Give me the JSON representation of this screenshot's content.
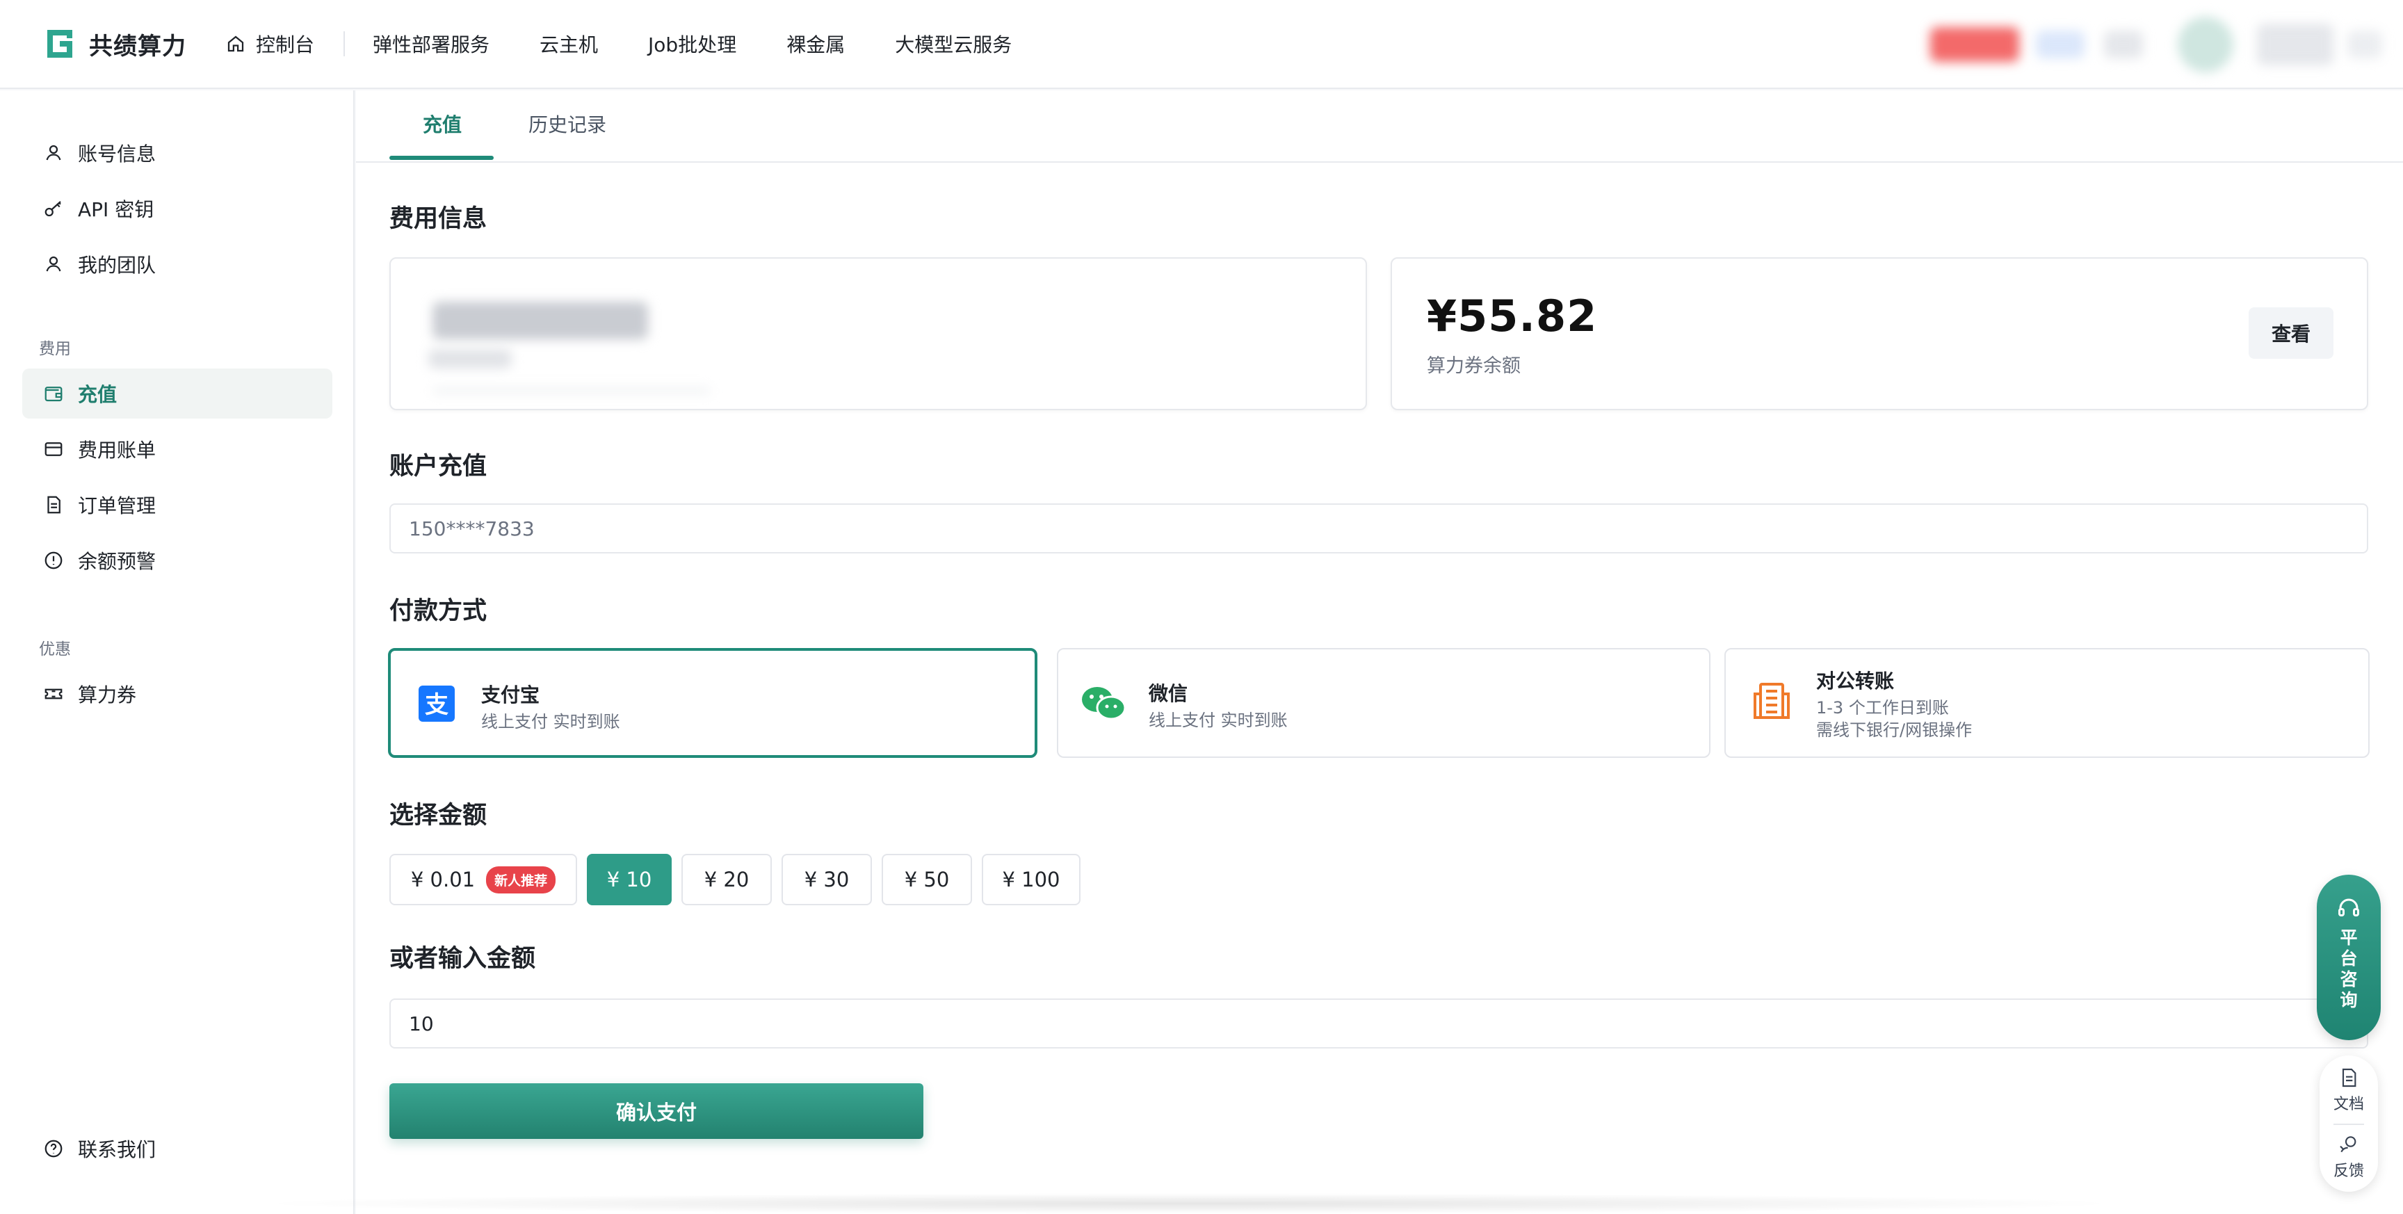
{
  "app": {
    "brand_name": "共绩算力"
  },
  "topnav": {
    "home": "控制台",
    "items": [
      "弹性部署服务",
      "云主机",
      "Job批处理",
      "裸金属",
      "大模型云服务"
    ]
  },
  "sidebar": {
    "account_items": [
      {
        "label": "账号信息",
        "icon": "user-icon"
      },
      {
        "label": "API 密钥",
        "icon": "key-icon"
      },
      {
        "label": "我的团队",
        "icon": "user-icon"
      }
    ],
    "fee_group": "费用",
    "fee_items": [
      {
        "label": "充值",
        "icon": "wallet-icon",
        "active": true
      },
      {
        "label": "费用账单",
        "icon": "card-icon"
      },
      {
        "label": "订单管理",
        "icon": "document-icon"
      },
      {
        "label": "余额预警",
        "icon": "alert-icon"
      }
    ],
    "promo_group": "优惠",
    "promo_items": [
      {
        "label": "算力券",
        "icon": "ticket-icon"
      }
    ],
    "contact": "联系我们"
  },
  "tabs": {
    "recharge": "充值",
    "history": "历史记录"
  },
  "fee_info": {
    "title": "费用信息",
    "voucher_amount": "¥55.82",
    "voucher_label": "算力券余额",
    "view_button": "查看"
  },
  "account_recharge": {
    "title": "账户充值",
    "account": "150****7833"
  },
  "payment": {
    "title": "付款方式",
    "methods": [
      {
        "name": "支付宝",
        "desc": "线上支付 实时到账",
        "icon": "alipay-icon",
        "selected": true
      },
      {
        "name": "微信",
        "desc": "线上支付 实时到账",
        "icon": "wechat-icon"
      },
      {
        "name": "对公转账",
        "desc": "1-3 个工作日到账",
        "desc2": "需线下银行/网银操作",
        "icon": "building-icon"
      }
    ]
  },
  "amount": {
    "title": "选择金额",
    "options": [
      "¥ 0.01",
      "¥ 10",
      "¥ 20",
      "¥ 30",
      "¥ 50",
      "¥ 100"
    ],
    "selected_index": 1,
    "new_user_badge": "新人推荐"
  },
  "custom_amount": {
    "title": "或者输入金额",
    "value": "10"
  },
  "confirm_button": "确认支付",
  "floating": {
    "consult": "平台咨询",
    "docs": "文档",
    "feedback": "反馈"
  },
  "colors": {
    "accent": "#1f8b79",
    "accent_dark": "#1f7e6e",
    "badge_red": "#e8434a",
    "alipay_blue": "#1677ff",
    "wechat_green": "#2aae67",
    "transfer_orange": "#f07a2a"
  }
}
